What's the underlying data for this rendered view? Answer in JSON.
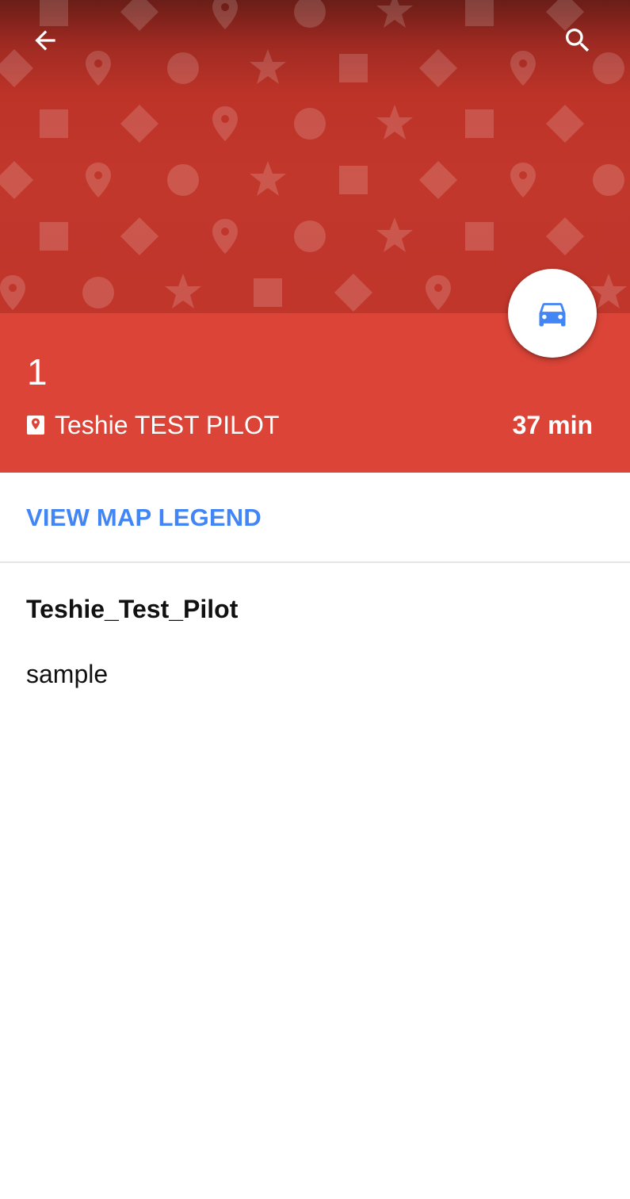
{
  "header": {
    "back_icon": "arrow-back-icon",
    "search_icon": "search-icon",
    "pattern_icons": [
      "square-icon",
      "diamond-icon",
      "pin-icon",
      "circle-icon",
      "star-icon"
    ]
  },
  "place": {
    "name": "1",
    "address": "Teshie TEST PILOT",
    "address_icon": "map-pin-icon",
    "travel_time": "37 min",
    "travel_mode_icon": "car-icon"
  },
  "actions": {
    "view_legend_label": "VIEW MAP LEGEND"
  },
  "description": {
    "title": "Teshie_Test_Pilot",
    "text": "sample"
  },
  "colors": {
    "header_top": "#6a1d17",
    "header_main": "#c2372c",
    "info_bar": "#db4437",
    "link": "#4285f4",
    "car_icon": "#4285f4"
  }
}
